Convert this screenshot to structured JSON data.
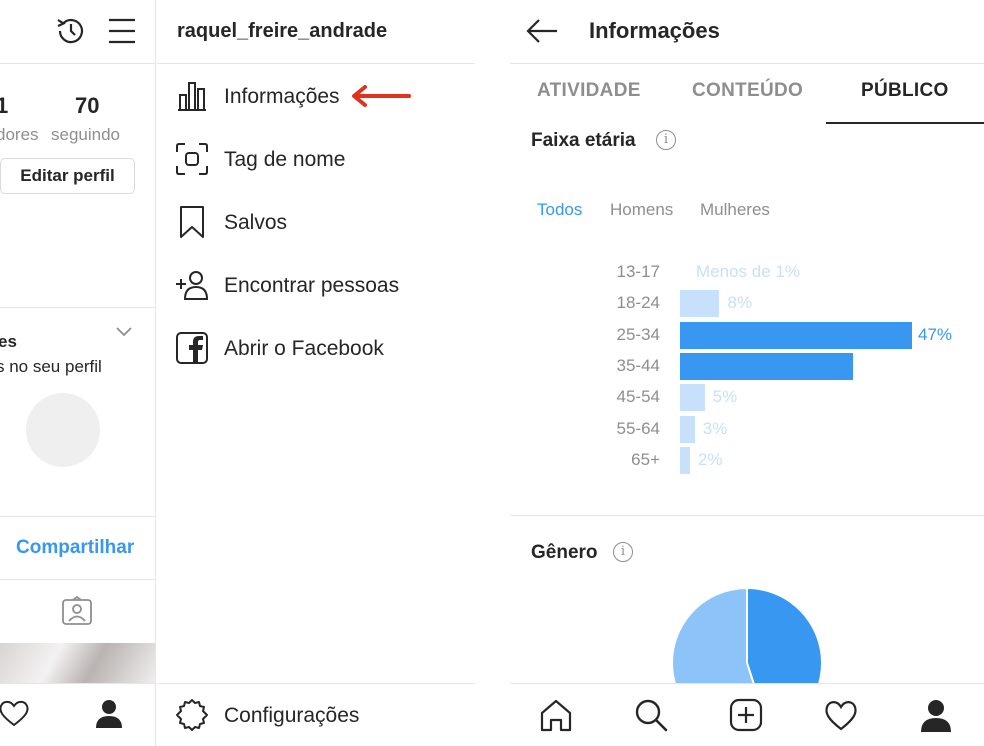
{
  "profile": {
    "followers_count_partial": "1",
    "followers_label_partial": "dores",
    "following_count": "70",
    "following_label": "seguindo",
    "edit_profile_label": "Editar perfil",
    "section_title_partial": "es",
    "section_sub_partial": "s no seu perfil",
    "share_label": "Compartilhar",
    "nav_icons": [
      "heart-icon",
      "profile-icon"
    ]
  },
  "menu": {
    "username": "raquel_freire_andrade",
    "items": [
      {
        "label": "Informações",
        "icon": "bar-chart-icon"
      },
      {
        "label": "Tag de nome",
        "icon": "nametag-icon"
      },
      {
        "label": "Salvos",
        "icon": "bookmark-icon"
      },
      {
        "label": "Encontrar pessoas",
        "icon": "add-person-icon"
      },
      {
        "label": "Abrir o Facebook",
        "icon": "facebook-icon"
      }
    ],
    "settings_label": "Configurações",
    "arrow_color": "#e0321c"
  },
  "insights": {
    "title": "Informações",
    "tabs": [
      "ATIVIDADE",
      "CONTEÚDO",
      "PÚBLICO"
    ],
    "active_tab": "PÚBLICO",
    "age_section_title": "Faixa etária",
    "filters": [
      "Todos",
      "Homens",
      "Mulheres"
    ],
    "active_filter": "Todos",
    "gender_section_title": "Gênero",
    "accent_color": "#3897f0",
    "light_bar_color": "#c7e0fb",
    "nav_icons": [
      "home-icon",
      "search-icon",
      "new-post-icon",
      "heart-icon",
      "profile-icon"
    ]
  },
  "chart_data": [
    {
      "type": "bar",
      "orientation": "horizontal",
      "title": "Faixa etária",
      "categories": [
        "13-17",
        "18-24",
        "25-34",
        "35-44",
        "45-54",
        "55-64",
        "65+"
      ],
      "values": [
        0.5,
        8,
        47,
        35,
        5,
        3,
        2
      ],
      "data_labels": [
        "Menos de 1%",
        "8%",
        "47%",
        "35%",
        "5%",
        "3%",
        "2%"
      ],
      "unit": "%",
      "highlighted_categories": [
        "25-34",
        "35-44"
      ]
    },
    {
      "type": "pie",
      "title": "Gênero",
      "values": [
        45,
        55
      ],
      "colors": [
        "#3897f0",
        "#8cc4fa"
      ]
    }
  ]
}
